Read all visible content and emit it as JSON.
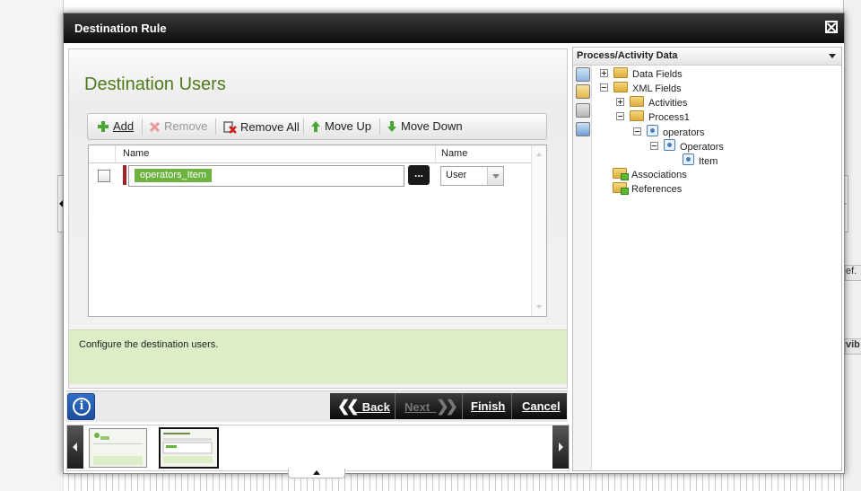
{
  "dialog": {
    "title": "Destination Rule"
  },
  "main": {
    "heading": "Destination Users",
    "toolbar": {
      "add": "Add",
      "remove": "Remove",
      "remove_all": "Remove All",
      "move_up": "Move Up",
      "move_down": "Move Down"
    },
    "grid": {
      "columns": [
        "Name",
        "Name"
      ],
      "rows": [
        {
          "value": "operators_Item",
          "ellipsis": "...",
          "type": "User"
        }
      ]
    },
    "info_text": "Configure the destination users."
  },
  "nav": {
    "back": "Back",
    "next": "Next",
    "finish": "Finish",
    "cancel": "Cancel"
  },
  "right_panel": {
    "title": "Process/Activity Data",
    "tree": [
      {
        "label": "Data Fields"
      },
      {
        "label": "XML Fields"
      },
      {
        "label": "Activities"
      },
      {
        "label": "Process1"
      },
      {
        "label": "operators"
      },
      {
        "label": "Operators"
      },
      {
        "label": "Item"
      },
      {
        "label": "Associations"
      },
      {
        "label": "References"
      }
    ]
  },
  "background": {
    "snippet_1": "ef.",
    "snippet_2": "vib"
  },
  "colors": {
    "heading": "#4d7a1a",
    "tag_green": "#6db33f",
    "info_band": "#ddedc8",
    "required_bar": "#a4212c",
    "info_button": "#2f6fc9"
  }
}
